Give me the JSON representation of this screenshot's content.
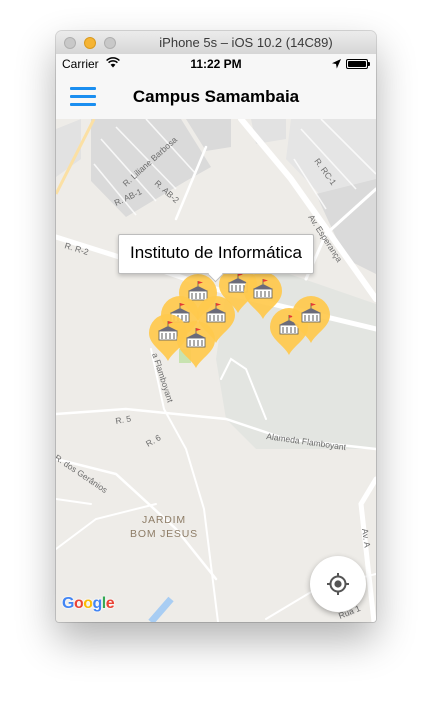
{
  "window": {
    "title": "iPhone 5s – iOS 10.2 (14C89)"
  },
  "status_bar": {
    "carrier": "Carrier",
    "time": "11:22 PM"
  },
  "nav": {
    "title": "Campus Samambaia",
    "menu_icon": "hamburger-menu-icon"
  },
  "map": {
    "callout": "Instituto de Informática",
    "street_labels": {
      "liliane": "R. Liliane Barbosa",
      "ab2": "R. AB-2",
      "ab1": "R. AB-1",
      "r2": "R. R-2",
      "rc1": "R. RC-1",
      "esperanca": "Av. Esperança",
      "flamboyant": "Alameda Flamboyant",
      "flamboyant_short": "a Flamboyant",
      "r5": "R. 5",
      "r6": "R. 6",
      "geranios": "R. dos Gerânios",
      "av_right": "Av. A",
      "rua1": "Rua 1"
    },
    "area_label": {
      "line1": "JARDIM",
      "line2": "BOM JESUS"
    },
    "google": [
      "G",
      "o",
      "o",
      "g",
      "l",
      "e"
    ],
    "marker_icon": "building-marker-icon",
    "locate_icon": "my-location-icon"
  },
  "colors": {
    "accent": "#1a8ef0",
    "marker": "#ffc94d",
    "map_background": "#eeece8",
    "campus_area": "#e3e5e1",
    "block": "#dadada",
    "road": "#ffffff",
    "highway": "#fbe0a4",
    "google": [
      "#4285f4",
      "#ea4335",
      "#fbbc05",
      "#4285f4",
      "#34a853",
      "#ea4335"
    ]
  }
}
